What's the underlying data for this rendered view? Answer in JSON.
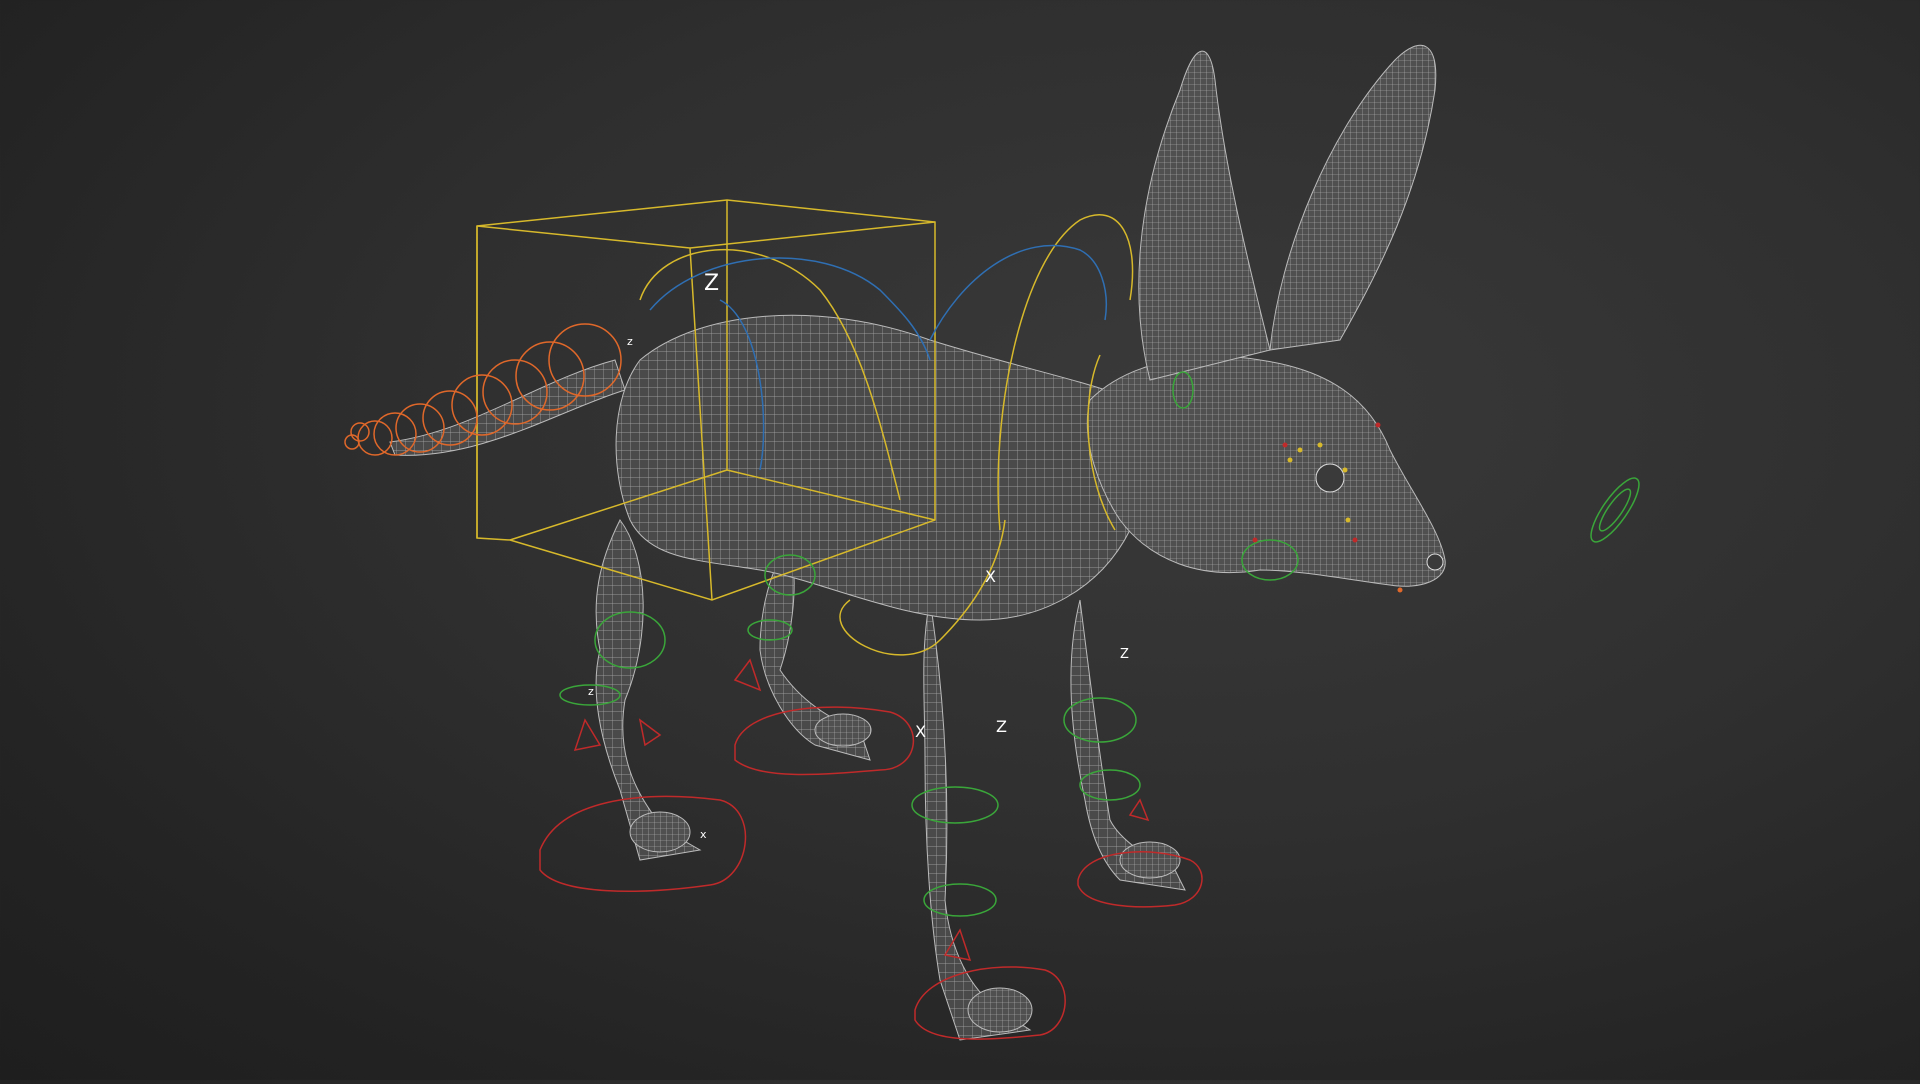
{
  "viewport": {
    "background_top": "#3a3a3a",
    "background_bottom": "#1e1e1e",
    "mesh_fill": "#4a4a4a",
    "mesh_wire": "#d9d9d9"
  },
  "controls": {
    "colors": {
      "root_box": "#d7b92b",
      "spine": "#d7b92b",
      "ik": "#2f6fb3",
      "tail": "#e0682a",
      "fk": "#3aa63a",
      "foot": "#c02a2a",
      "offset": "#c02a2a"
    },
    "axis_labels": {
      "root_z": "Z",
      "spine_x": "X",
      "hip_z": "Z",
      "leg_x": "X",
      "front_z": "Z",
      "tail_z": "z",
      "knee_z": "z",
      "toe_x": "x"
    }
  },
  "icons": [
    "wireframe-mesh-icon",
    "rig-control-icon"
  ]
}
